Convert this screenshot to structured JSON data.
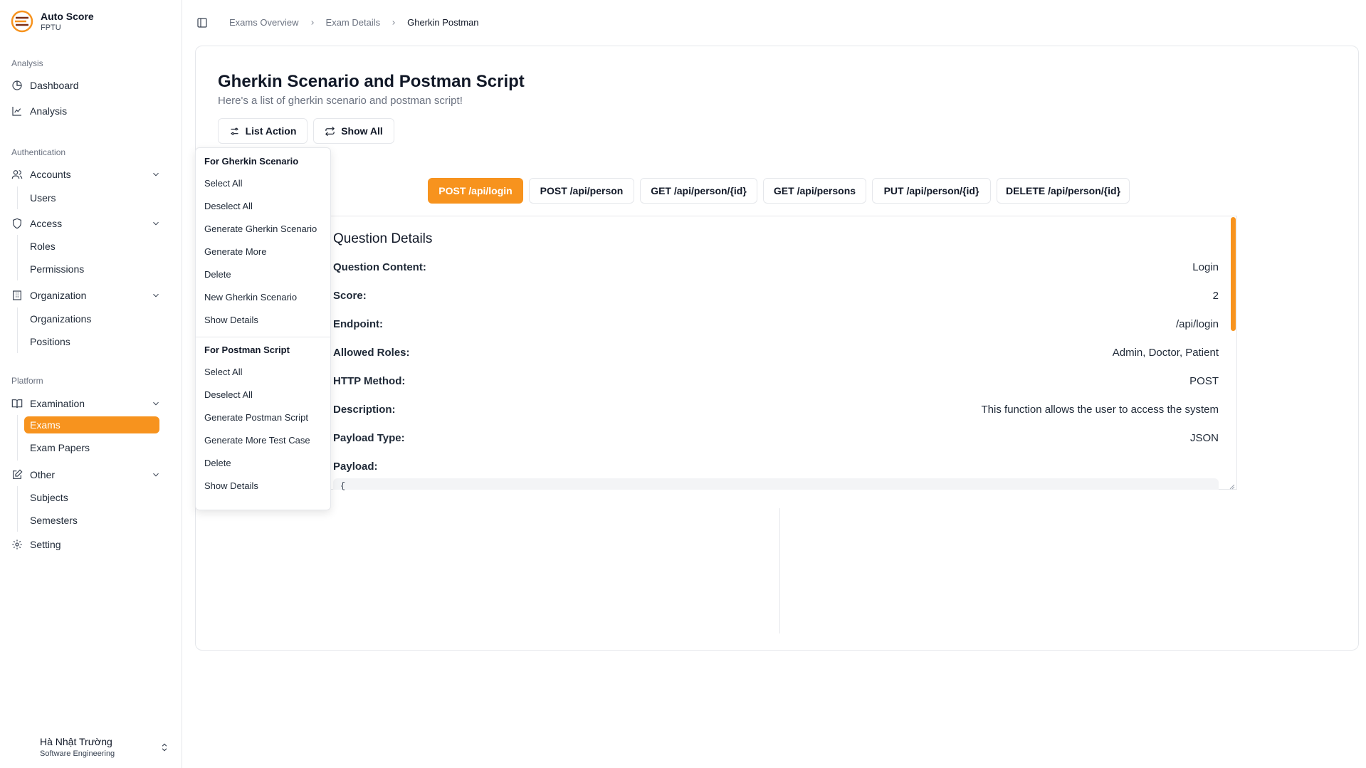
{
  "brand": {
    "name": "Auto Score",
    "sub": "FPTU"
  },
  "sidebar": {
    "sections": {
      "analysis": "Analysis",
      "authentication": "Authentication",
      "platform": "Platform"
    },
    "items": {
      "dashboard": "Dashboard",
      "analysis": "Analysis",
      "accounts": "Accounts",
      "users": "Users",
      "access": "Access",
      "roles": "Roles",
      "permissions": "Permissions",
      "organization": "Organization",
      "organizations": "Organizations",
      "positions": "Positions",
      "examination": "Examination",
      "exams": "Exams",
      "exam_papers": "Exam Papers",
      "other": "Other",
      "subjects": "Subjects",
      "semesters": "Semesters",
      "setting": "Setting"
    }
  },
  "user": {
    "name": "Hà Nhật Trường",
    "role": "Software Engineering"
  },
  "breadcrumb": [
    "Exams Overview",
    "Exam Details",
    "Gherkin Postman"
  ],
  "page": {
    "title": "Gherkin Scenario and Postman Script",
    "subtitle": "Here's a list of gherkin scenario and postman script!",
    "list_action": "List Action",
    "show_all": "Show All"
  },
  "tabs": [
    "POST /api/login",
    "POST /api/person",
    "GET /api/person/{id}",
    "GET /api/persons",
    "PUT /api/person/{id}",
    "DELETE /api/person/{id}"
  ],
  "details": {
    "title": "Question Details",
    "rows": [
      {
        "label": "Question Content:",
        "value": "Login"
      },
      {
        "label": "Score:",
        "value": "2"
      },
      {
        "label": "Endpoint:",
        "value": "/api/login"
      },
      {
        "label": "Allowed Roles:",
        "value": "Admin, Doctor, Patient"
      },
      {
        "label": "HTTP Method:",
        "value": "POST"
      },
      {
        "label": "Description:",
        "value": "This function allows the user to access the system"
      },
      {
        "label": "Payload Type:",
        "value": "JSON"
      },
      {
        "label": "Payload:",
        "value": ""
      }
    ],
    "payload_start": "{"
  },
  "menu": {
    "gherkin_head": "For Gherkin Scenario",
    "gherkin_items": [
      "Select All",
      "Deselect All",
      "Generate Gherkin Scenario",
      "Generate More",
      "Delete",
      "New Gherkin Scenario",
      "Show Details"
    ],
    "postman_head": "For Postman Script",
    "postman_items": [
      "Select All",
      "Deselect All",
      "Generate Postman Script",
      "Generate More Test Case",
      "Delete",
      "Show Details"
    ]
  },
  "colors": {
    "accent": "#f7931e",
    "border": "#e5e7eb",
    "muted": "#6b7280"
  }
}
